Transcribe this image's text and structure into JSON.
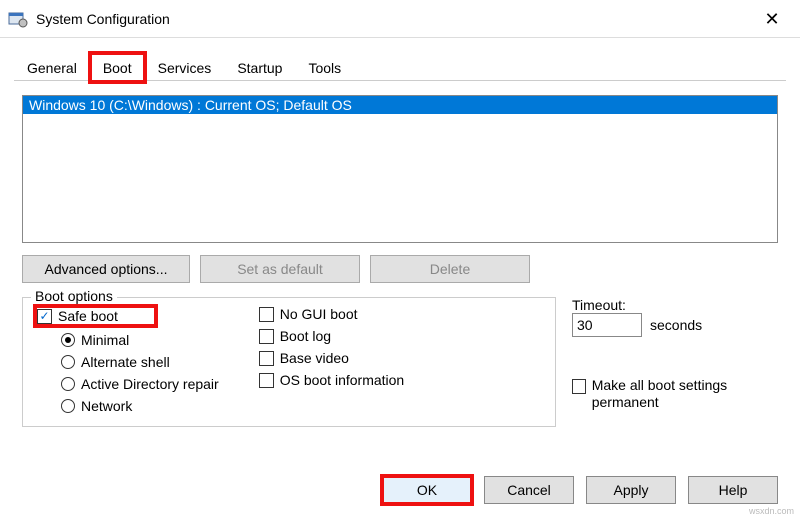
{
  "window": {
    "title": "System Configuration"
  },
  "tabs": {
    "general": "General",
    "boot": "Boot",
    "services": "Services",
    "startup": "Startup",
    "tools": "Tools"
  },
  "list": {
    "item0": "Windows 10 (C:\\Windows) : Current OS; Default OS"
  },
  "buttons": {
    "advanced": "Advanced options...",
    "setdefault": "Set as default",
    "delete": "Delete"
  },
  "boot_options": {
    "legend": "Boot options",
    "safe_boot": "Safe boot",
    "minimal": "Minimal",
    "alternate": "Alternate shell",
    "adrepair": "Active Directory repair",
    "network": "Network",
    "nogui": "No GUI boot",
    "bootlog": "Boot log",
    "basevideo": "Base video",
    "osinfo": "OS boot information"
  },
  "timeout": {
    "label": "Timeout:",
    "value": "30",
    "suffix": "seconds",
    "permanent": "Make all boot settings permanent"
  },
  "footer": {
    "ok": "OK",
    "cancel": "Cancel",
    "apply": "Apply",
    "help": "Help"
  },
  "watermark": "wsxdn.com"
}
